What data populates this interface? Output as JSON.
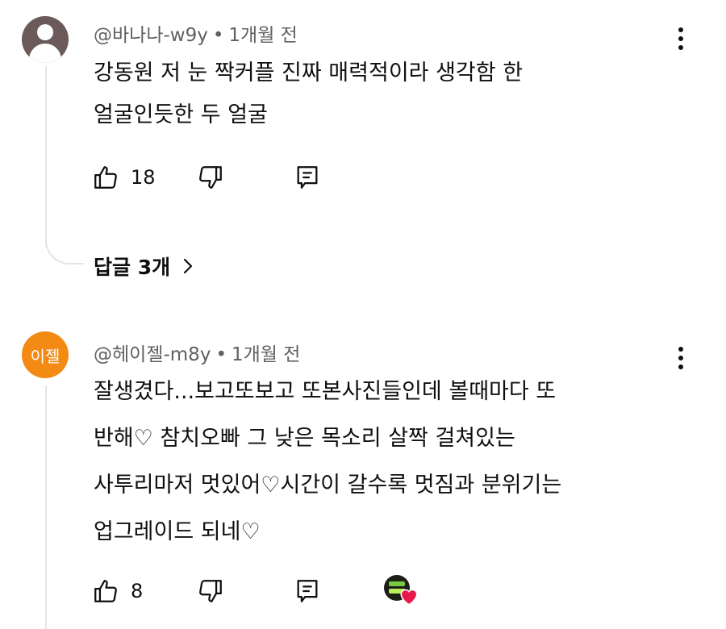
{
  "comments": [
    {
      "handle": "@바나나-w9y",
      "separator": "•",
      "time": "1개월 전",
      "avatar": {
        "icon": "default-user-avatar",
        "color": "#6b5a59"
      },
      "lines": [
        "강동원 저 눈 짝커플 진짜 매력적이라 생각함 한",
        "얼굴인듯한 두 얼굴"
      ],
      "likes": "18",
      "replies_label": "답글 3개"
    },
    {
      "handle": "@헤이젤-m8y",
      "separator": "•",
      "time": "1개월 전",
      "avatar": {
        "label": "이젤",
        "color": "#f28a13"
      },
      "lines": [
        "잘생겼다...보고또보고 또본사진들인데 볼때마다 또",
        "반해♡ 참치오빠 그 낮은 목소리 살짝 걸쳐있는",
        "사투리마저 멋있어♡시간이 갈수록 멋짐과 분위기는",
        "업그레이드 되네♡"
      ],
      "likes": "8",
      "creator_heart": {
        "icon": "creator-heart-icon",
        "color": "#e8194a"
      }
    }
  ]
}
